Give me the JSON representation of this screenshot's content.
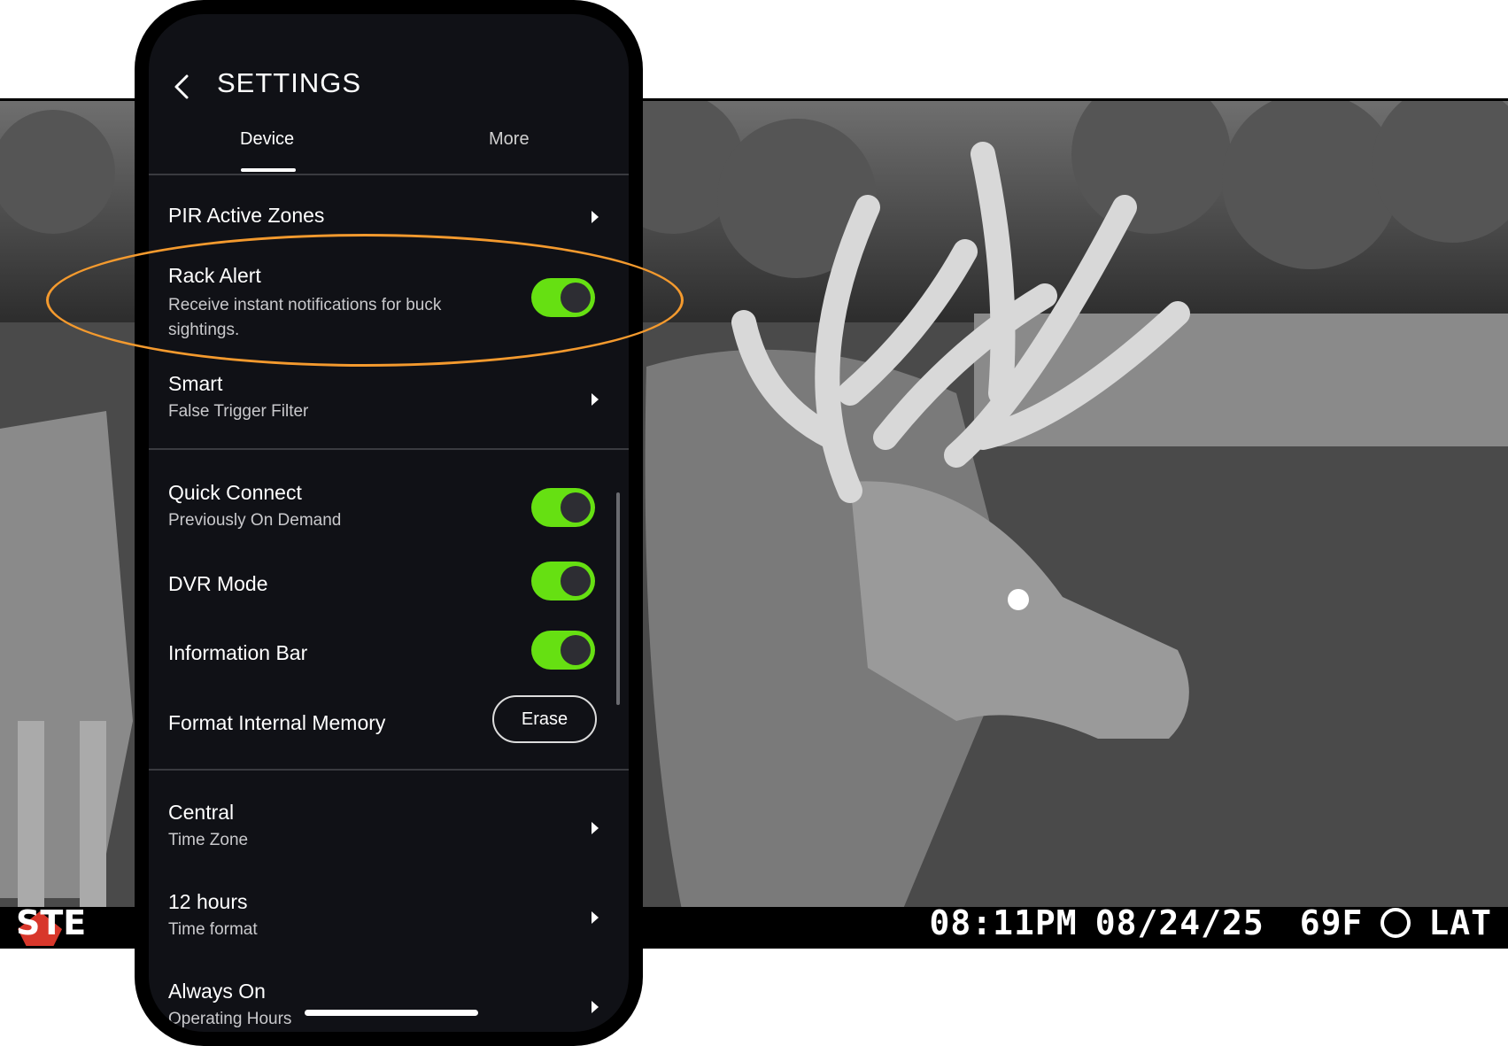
{
  "header": {
    "title": "SETTINGS",
    "back_icon": "chevron-left-icon"
  },
  "tabs": [
    {
      "label": "Device",
      "active": true
    },
    {
      "label": "More",
      "active": false
    }
  ],
  "settings": {
    "pir": {
      "title": "PIR Active Zones"
    },
    "rack_alert": {
      "title": "Rack Alert",
      "subtitle_line1": "Receive instant notifications for buck",
      "subtitle_line2": "sightings.",
      "enabled": true
    },
    "smart": {
      "title": "Smart",
      "subtitle": "False Trigger Filter"
    },
    "quick_connect": {
      "title": "Quick Connect",
      "subtitle": "Previously On Demand",
      "enabled": true
    },
    "dvr": {
      "title": "DVR Mode",
      "enabled": true
    },
    "info_bar": {
      "title": "Information Bar",
      "enabled": true
    },
    "format": {
      "title": "Format Internal Memory",
      "button": "Erase"
    },
    "time_zone": {
      "title": "Central",
      "subtitle": "Time Zone"
    },
    "time_format": {
      "title": "12 hours",
      "subtitle": "Time format"
    },
    "operating_hours": {
      "title": "Always On",
      "subtitle": "Operating Hours"
    }
  },
  "camera_stamp": {
    "brand": "STE",
    "time": "08:11PM",
    "date": "08/24/25",
    "temp": "69F",
    "location": "LAT"
  },
  "colors": {
    "toggle_on": "#66e012",
    "highlight": "#f49a2e",
    "screen_bg": "#101116"
  }
}
